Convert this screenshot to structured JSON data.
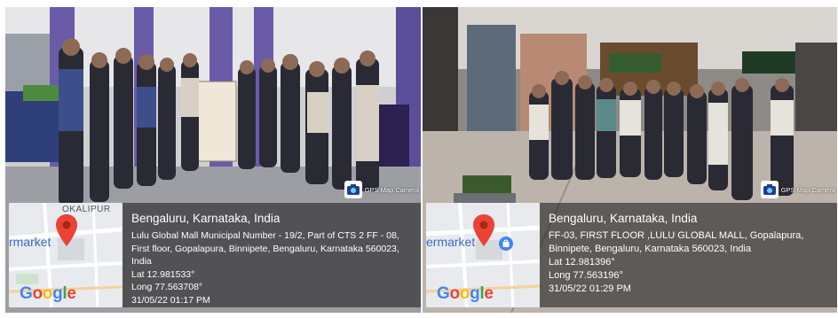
{
  "photos": [
    {
      "badge_text": "GPS Map Camera",
      "map": {
        "street_label": "OKALIPUR",
        "poi_label": "rmarket",
        "logo": "Google"
      },
      "location": {
        "title": "Bengaluru, Karnataka, India",
        "address_lines": [
          "Lulu Global Mall Municipal Number - 19/2, Part of CTS 2 FF - 08,",
          "First floor, Gopalapura, Binnipete, Bengaluru, Karnataka 560023,",
          "India"
        ],
        "lat": "Lat 12.981533°",
        "long": "Long 77.563708°",
        "datetime": "31/05/22 01:17 PM"
      }
    },
    {
      "badge_text": "GPS Map Camera",
      "map": {
        "street_label": "",
        "poi_label": "ermarket",
        "logo": "Google"
      },
      "location": {
        "title": "Bengaluru, Karnataka, India",
        "address_lines": [
          "FF-03, FIRST FLOOR ,LULU GLOBAL MALL, Gopalapura,",
          "Binnipete, Bengaluru, Karnataka 560023, India"
        ],
        "lat": "Lat 12.981396°",
        "long": "Long 77.563196°",
        "datetime": "31/05/22 01:29 PM"
      }
    }
  ],
  "colors": {
    "pin_red": "#ea4335",
    "panel_bg": "#232323",
    "purple_pillar": "#6a5ba8"
  },
  "icons": [
    "map-pin-icon",
    "gps-camera-icon",
    "shopping-bag-icon"
  ]
}
